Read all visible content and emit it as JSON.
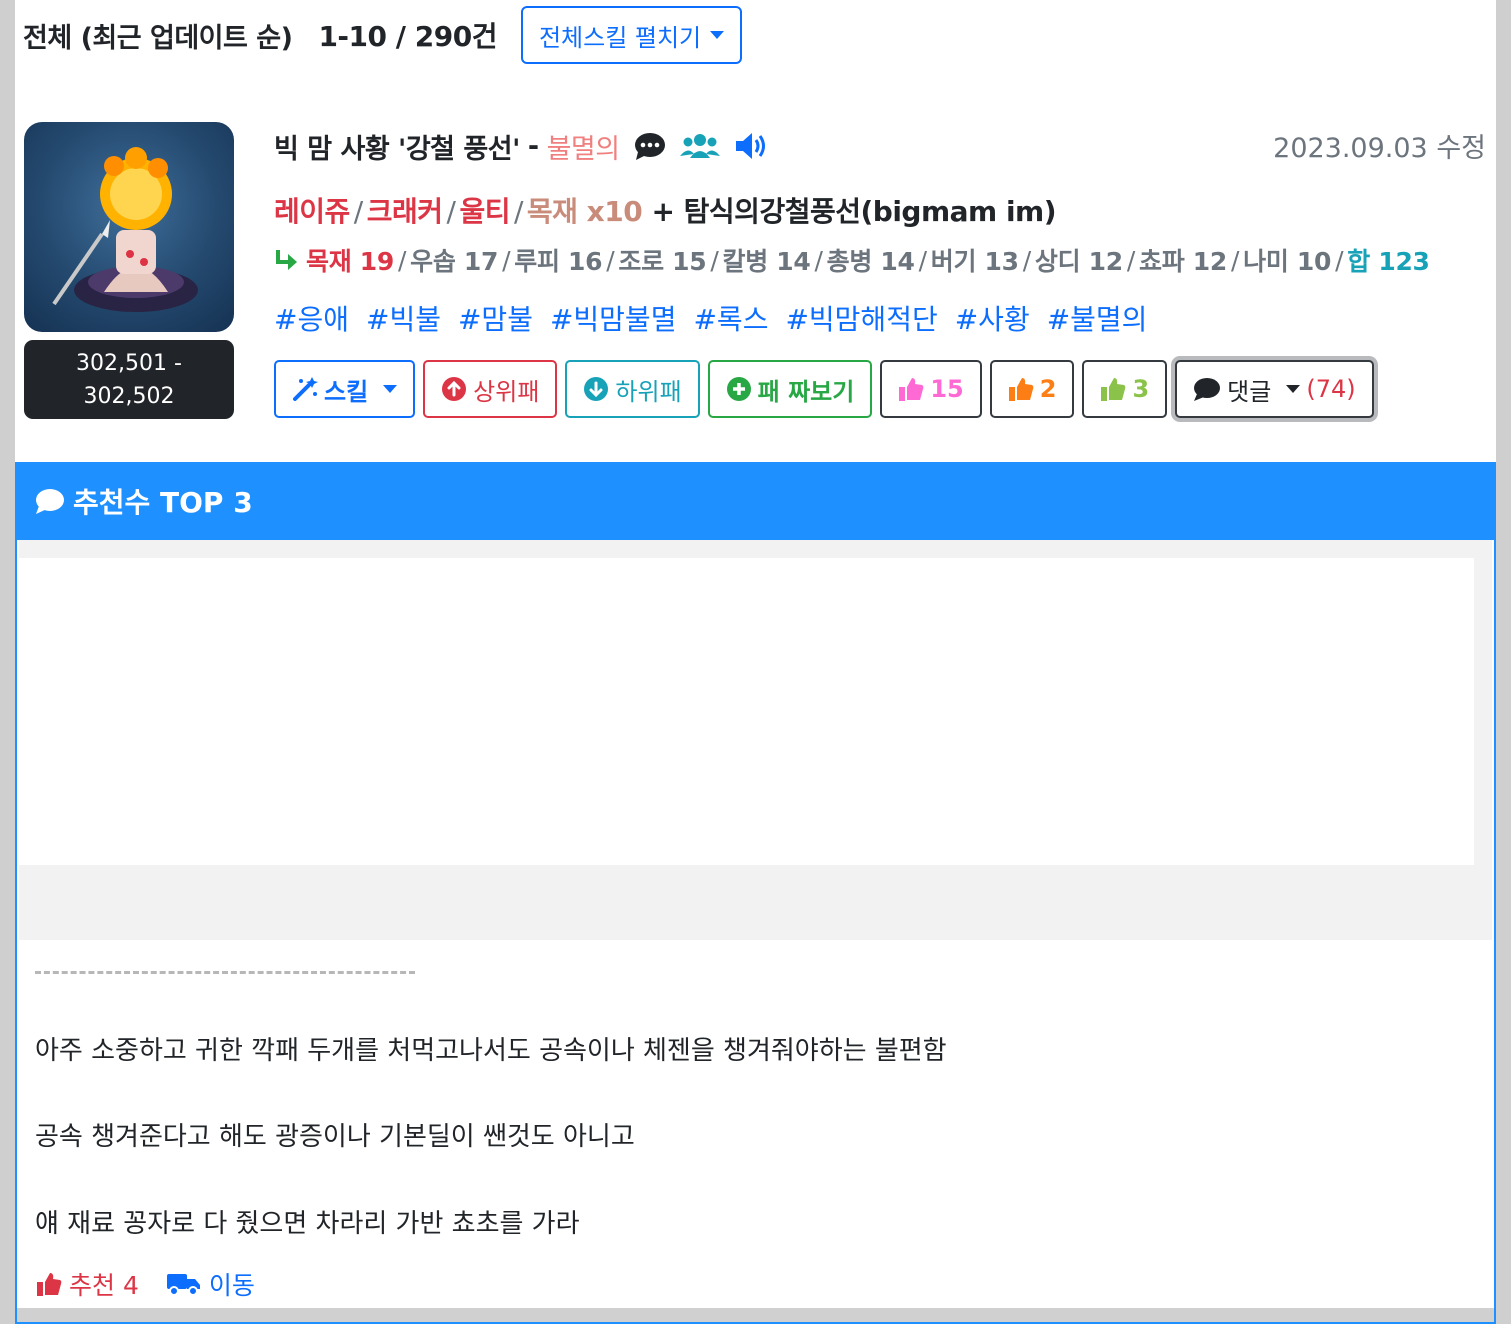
{
  "header": {
    "title": "전체 (최근 업데이트 순)",
    "count": "1-10 / 290건",
    "expand_button": "전체스킬 펼치기"
  },
  "deck": {
    "score": [
      "302,501 -",
      "302,502"
    ],
    "title": "빅 맘 사황 '강철 풍선'",
    "dash": "-",
    "badge": "불멸의",
    "date": "2023.09.03 수정",
    "combo": {
      "parts": [
        "레이쥬",
        "크래커",
        "울티"
      ],
      "extra": "목재 x10",
      "plus": "+ 탐식의강철풍선(bigmam im)"
    },
    "stats": {
      "items": [
        "목재 19",
        "우솝 17",
        "루피 16",
        "조로 15",
        "칼병 14",
        "총병 14",
        "버기 13",
        "상디 12",
        "쵸파 12",
        "나미 10"
      ],
      "total": "합 123"
    },
    "tags": [
      "#응애",
      "#빅불",
      "#맘불",
      "#빅맘불멸",
      "#록스",
      "#빅맘해적단",
      "#사황",
      "#불멸의"
    ],
    "buttons": {
      "skill": "스킬",
      "upper": "상위패",
      "lower": "하위패",
      "build": "패 짜보기",
      "like_pink": "15",
      "like_orange": "2",
      "like_green": "3",
      "comment": "댓글",
      "comment_count": "(74)"
    }
  },
  "top3": {
    "title": "추천수 TOP 3",
    "lines": [
      "아주 소중하고 귀한 깍패 두개를 처먹고나서도 공속이나 체젠을 챙겨줘야하는 불편함",
      "공속 챙겨준다고 해도 광증이나 기본딜이 쌘것도 아니고",
      "얘 재료 꽁자로 다 줬으면 차라리 가반 쵸초를 가라"
    ],
    "recommend": "추천 4",
    "move": "이동"
  },
  "colors": {
    "primary": "#0d6efd",
    "panel_blue": "#1e90ff",
    "red": "#dc3545",
    "teal": "#17a2b8",
    "green": "#28a745",
    "pink_like": "#ff69d4",
    "orange_like": "#fd7e14",
    "green_like": "#8bc34a"
  },
  "icons": [
    "caret-down-icon",
    "comment-dots-icon",
    "users-icon",
    "volume-icon",
    "share-arrow-icon",
    "magic-wand-icon",
    "arrow-circle-up-icon",
    "arrow-circle-down-icon",
    "plus-circle-icon",
    "thumbs-up-icon",
    "comment-icon",
    "truck-icon"
  ]
}
